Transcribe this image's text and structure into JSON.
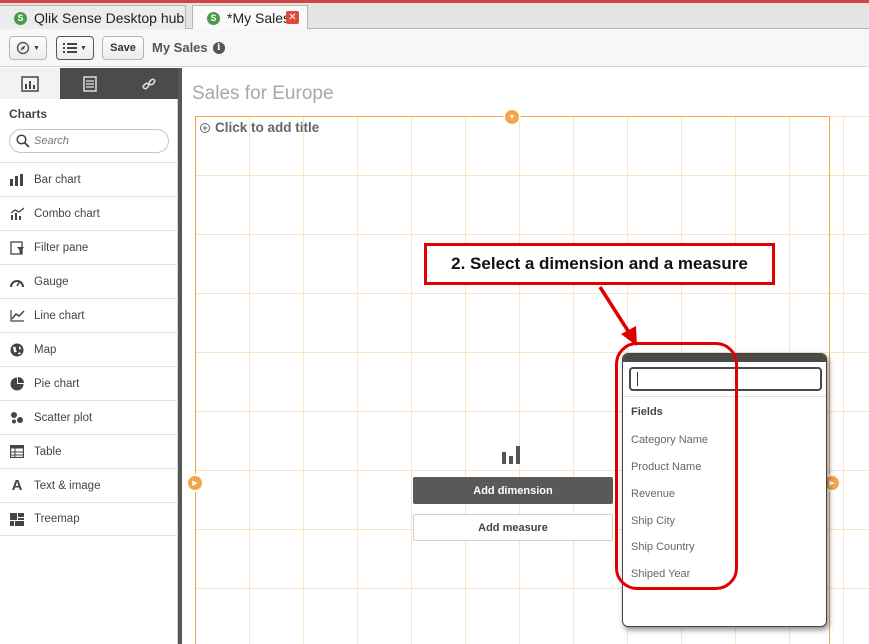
{
  "tabs": [
    {
      "label": "Qlik Sense Desktop hub",
      "icon": "qlik-icon"
    },
    {
      "label": "*My Sales",
      "icon": "qlik-icon",
      "close": "✕"
    }
  ],
  "toolbar": {
    "save_label": "Save",
    "app_title": "My Sales",
    "info": "i"
  },
  "left_panel": {
    "heading": "Charts",
    "search_placeholder": "Search",
    "items": [
      {
        "label": "Bar chart",
        "icon": "bar-chart-icon"
      },
      {
        "label": "Combo chart",
        "icon": "combo-chart-icon"
      },
      {
        "label": "Filter pane",
        "icon": "filter-pane-icon"
      },
      {
        "label": "Gauge",
        "icon": "gauge-icon"
      },
      {
        "label": "Line chart",
        "icon": "line-chart-icon"
      },
      {
        "label": "Map",
        "icon": "map-icon"
      },
      {
        "label": "Pie chart",
        "icon": "pie-chart-icon"
      },
      {
        "label": "Scatter plot",
        "icon": "scatter-plot-icon"
      },
      {
        "label": "Table",
        "icon": "table-icon"
      },
      {
        "label": "Text & image",
        "icon": "text-image-icon"
      },
      {
        "label": "Treemap",
        "icon": "treemap-icon"
      }
    ]
  },
  "sheet": {
    "title": "Sales for Europe",
    "add_title": "Click to add title",
    "add_dimension": "Add dimension",
    "add_measure": "Add measure"
  },
  "fields_popup": {
    "heading": "Fields",
    "fields": [
      "Category Name",
      "Product Name",
      "Revenue",
      "Ship City",
      "Ship Country",
      "Shiped Year"
    ]
  },
  "annotation": {
    "text": "2. Select a dimension and a measure",
    "color": "#e00000"
  },
  "colors": {
    "accent": "#f5a54a",
    "dark": "#4b4b4b"
  }
}
